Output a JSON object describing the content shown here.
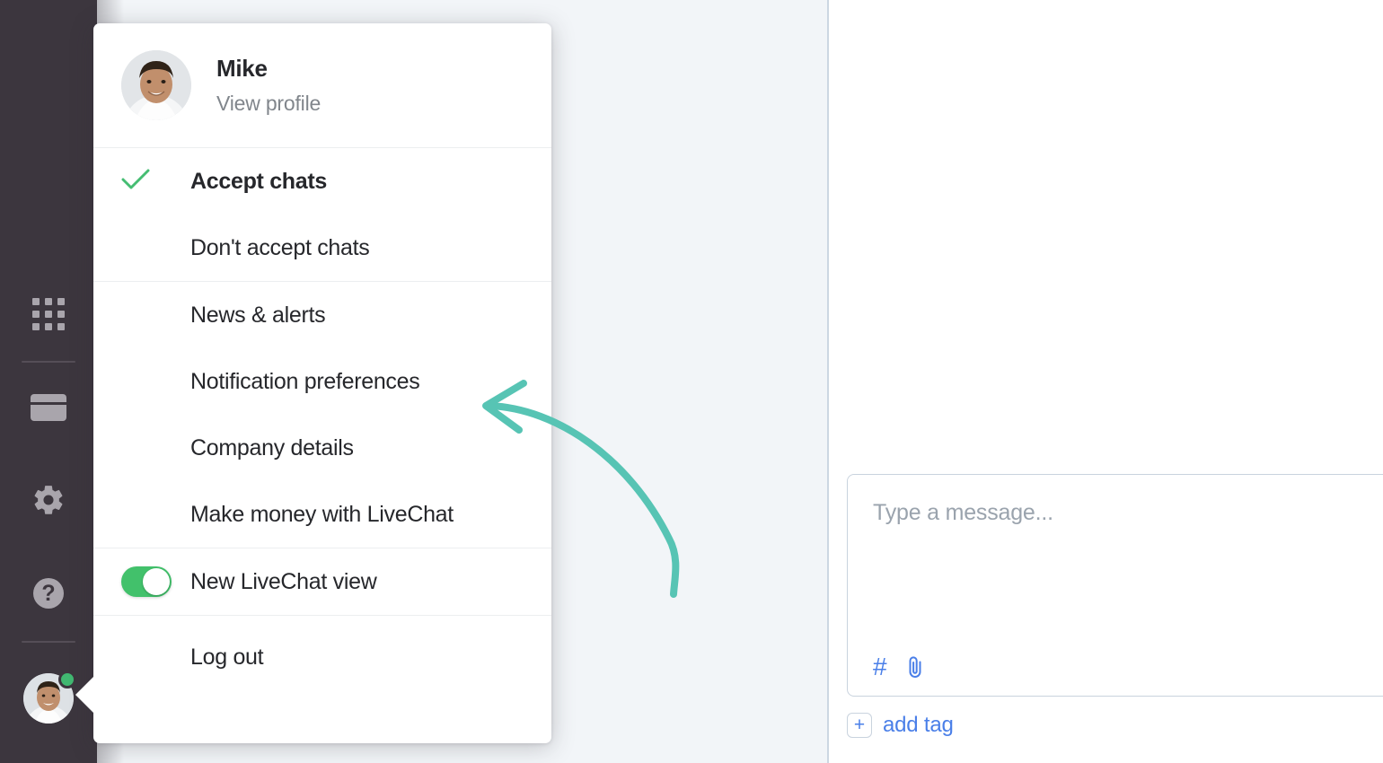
{
  "colors": {
    "sidebar_bg": "#3c363e",
    "mid_bg": "#f2f5f8",
    "panel_bg": "#ffffff",
    "accent_green": "#42c16b",
    "check_green": "#45bd72",
    "link_blue": "#4a7fe8",
    "annotation_teal": "#57c4b4",
    "text_dark": "#26272b",
    "text_muted": "#81868c",
    "border_light": "#eceef0",
    "border_blue_gray": "#ccd7e2"
  },
  "sidebar": {
    "items": [
      {
        "name": "apps-grid",
        "icon": "grid-icon"
      },
      {
        "name": "reports-card",
        "icon": "card-icon"
      },
      {
        "name": "settings",
        "icon": "gear-icon"
      },
      {
        "name": "help",
        "icon": "question-mark-icon",
        "glyph": "?"
      }
    ],
    "avatar": {
      "name": "agent-avatar",
      "status": "online"
    }
  },
  "panel": {
    "header": {
      "name": "Mike",
      "link": "View profile",
      "avatar_alt": "Mike"
    },
    "groups": [
      {
        "items": [
          {
            "label": "Accept chats",
            "bold": true,
            "icon": "check-icon",
            "checked": true
          },
          {
            "label": "Don't accept chats",
            "bold": false,
            "icon": null,
            "checked": false
          }
        ]
      },
      {
        "items": [
          {
            "label": "News & alerts",
            "bold": false,
            "icon": null
          },
          {
            "label": "Notification preferences",
            "bold": false,
            "icon": null
          },
          {
            "label": "Company details",
            "bold": false,
            "icon": null
          },
          {
            "label": "Make money with LiveChat",
            "bold": false,
            "icon": null
          }
        ]
      },
      {
        "items": [
          {
            "label": "New LiveChat view",
            "bold": false,
            "icon": "toggle-switch",
            "toggle_on": true
          }
        ]
      },
      {
        "items": [
          {
            "label": "Log out",
            "bold": false,
            "icon": null
          }
        ]
      }
    ]
  },
  "composer": {
    "placeholder": "Type a message...",
    "tools": [
      {
        "name": "canned-response-hash-icon",
        "glyph": "#"
      },
      {
        "name": "attachment-paperclip-icon",
        "glyph": "paperclip"
      }
    ],
    "add_tag": {
      "plus": "+",
      "label": "add tag"
    }
  },
  "annotation": {
    "type": "curved-arrow",
    "points_to": "Notification preferences",
    "color": "#57c4b4"
  }
}
